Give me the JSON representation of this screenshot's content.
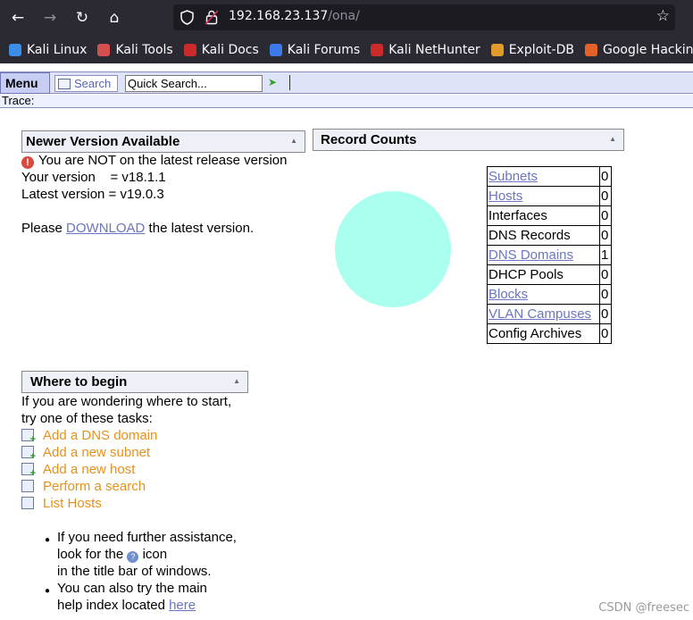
{
  "browser": {
    "url_host": "192.168.23.137",
    "url_path": "/ona/",
    "bookmarks": [
      {
        "label": "Kali Linux",
        "color": "#3b8ee8"
      },
      {
        "label": "Kali Tools",
        "color": "#d64f4f"
      },
      {
        "label": "Kali Docs",
        "color": "#cc2b2b"
      },
      {
        "label": "Kali Forums",
        "color": "#3b7be8"
      },
      {
        "label": "Kali NetHunter",
        "color": "#cc2b2b"
      },
      {
        "label": "Exploit-DB",
        "color": "#e39a2a"
      },
      {
        "label": "Google Hacking DB",
        "color": "#e3622a"
      }
    ]
  },
  "menubar": {
    "menu_label": "Menu",
    "search_label": "Search",
    "quick_search_value": "Quick Search...",
    "trace_label": "Trace:"
  },
  "version_box": {
    "title": "Newer Version Available",
    "warning": "You are NOT on the latest release version",
    "your_version": "Your version    = v18.1.1",
    "latest_version": "Latest version = v19.0.3",
    "download_prefix": "Please ",
    "download_link": "DOWNLOAD",
    "download_suffix": " the latest version."
  },
  "record_counts": {
    "title": "Record Counts",
    "pie_color": "#aaffee",
    "rows": [
      {
        "label": "Subnets",
        "value": "0",
        "link": true
      },
      {
        "label": "Hosts",
        "value": "0",
        "link": true
      },
      {
        "label": "Interfaces",
        "value": "0",
        "link": false
      },
      {
        "label": "DNS Records",
        "value": "0",
        "link": false
      },
      {
        "label": "DNS Domains",
        "value": "1",
        "link": true
      },
      {
        "label": "DHCP Pools",
        "value": "0",
        "link": false
      },
      {
        "label": "Blocks",
        "value": "0",
        "link": true
      },
      {
        "label": "VLAN Campuses",
        "value": "0",
        "link": true
      },
      {
        "label": "Config Archives",
        "value": "0",
        "link": false
      }
    ]
  },
  "begin_box": {
    "title": "Where to begin",
    "intro1": "If you are wondering where to start,",
    "intro2": "try one of these tasks:",
    "tasks": [
      {
        "label": "Add a DNS domain",
        "icon": "add-domain-icon"
      },
      {
        "label": "Add a new subnet",
        "icon": "add-subnet-icon"
      },
      {
        "label": "Add a new host",
        "icon": "add-host-icon"
      },
      {
        "label": "Perform a search",
        "icon": "search-icon"
      },
      {
        "label": "List Hosts",
        "icon": "list-icon"
      }
    ],
    "help1_a": "If you need further assistance,",
    "help1_b": "look for the",
    "help1_c": "icon",
    "help1_d": "in the title bar of windows.",
    "help2_a": "You can also try the main",
    "help2_b": "help index located ",
    "help2_link": "here"
  },
  "watermark": "CSDN @freesec"
}
